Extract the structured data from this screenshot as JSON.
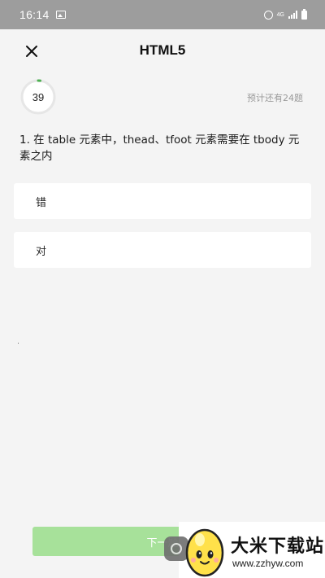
{
  "status_bar": {
    "time": "16:14",
    "network": "4G"
  },
  "header": {
    "title": "HTML5",
    "close_icon": "close-icon"
  },
  "quiz": {
    "timer_value": "39",
    "remaining_text": "预计还有24题",
    "question": "1. 在 table 元素中，thead、tfoot 元素需要在 tbody 元素之内",
    "options": [
      {
        "label": "错"
      },
      {
        "label": "对"
      }
    ],
    "next_label": "下一题"
  },
  "watermark": {
    "title": "大米下载站",
    "url": "www.zzhyw.com"
  },
  "colors": {
    "accent_green": "#a7e19a",
    "timer_green": "#4caf50",
    "status_bar": "#9d9d9d",
    "background": "#f4f4f4"
  }
}
